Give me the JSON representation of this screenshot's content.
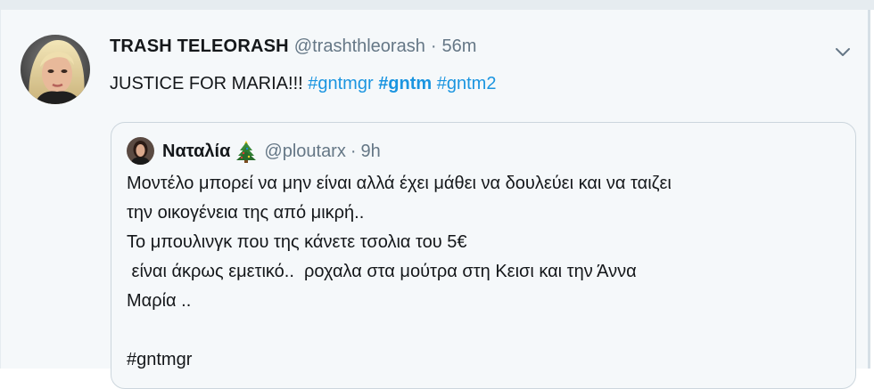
{
  "tweet": {
    "display_name": "TRASH TELEORASH",
    "handle": "@trashthleorash",
    "separator": "·",
    "time": "56m",
    "text_prefix": "JUSTICE FOR MARIA!!! ",
    "hashtags": [
      "#gntmgr",
      "#gntm",
      "#gntm2"
    ],
    "avatar_icon": "profile-photo",
    "menu_icon": "chevron-down-icon"
  },
  "quote": {
    "display_name": "Ναταλία",
    "emoji_icon": "christmas-tree-icon",
    "handle": "@ploutarx",
    "separator": "·",
    "time": "9h",
    "lines": [
      "Μοντέλο μπορεί να μην είναι αλλά έχει μάθει να δουλεύει και να ταιζει",
      "την οικογένεια της από μικρή..",
      "Το μπουλινγκ που της κάνετε τσολια του 5€",
      " είναι άκρως εμετικό..  ροχαλα στα μούτρα στη Κεισι και την Άννα",
      "Μαρία ..",
      "",
      "#gntmgr"
    ]
  },
  "colors": {
    "background": "#f5f8fa",
    "border": "#ccd6dd",
    "link": "#1b95e0",
    "text": "#14171a",
    "secondary": "#657786"
  }
}
